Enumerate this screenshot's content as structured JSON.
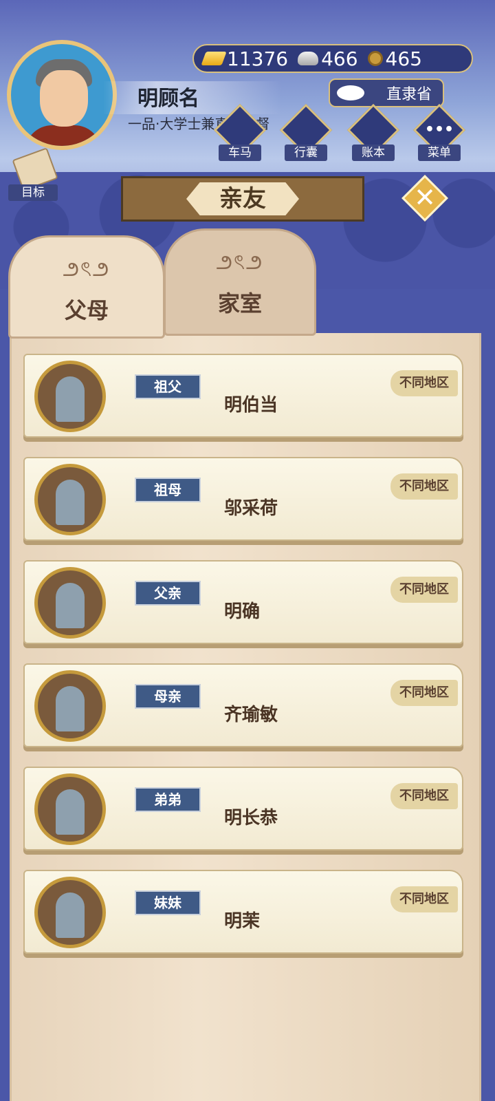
{
  "player": {
    "name": "明顾名",
    "title": "一品·大学士兼直隶总督"
  },
  "resources": {
    "gold": "11376",
    "silver": "466",
    "coins": "465"
  },
  "region": "直隶省",
  "menu": [
    {
      "label": "车马",
      "icon": "carriage-icon"
    },
    {
      "label": "行囊",
      "icon": "bag-icon"
    },
    {
      "label": "账本",
      "icon": "ledger-icon"
    },
    {
      "label": "菜单",
      "icon": "more-icon"
    }
  ],
  "goal_label": "目标",
  "panel_title": "亲友",
  "tabs": [
    "父母",
    "家室"
  ],
  "relatives": [
    {
      "relation": "祖父",
      "name": "明伯当",
      "status": "不同地区"
    },
    {
      "relation": "祖母",
      "name": "邬采荷",
      "status": "不同地区"
    },
    {
      "relation": "父亲",
      "name": "明确",
      "status": "不同地区"
    },
    {
      "relation": "母亲",
      "name": "齐瑜敏",
      "status": "不同地区"
    },
    {
      "relation": "弟弟",
      "name": "明长恭",
      "status": "不同地区"
    },
    {
      "relation": "妹妹",
      "name": "明茉",
      "status": "不同地区"
    }
  ]
}
